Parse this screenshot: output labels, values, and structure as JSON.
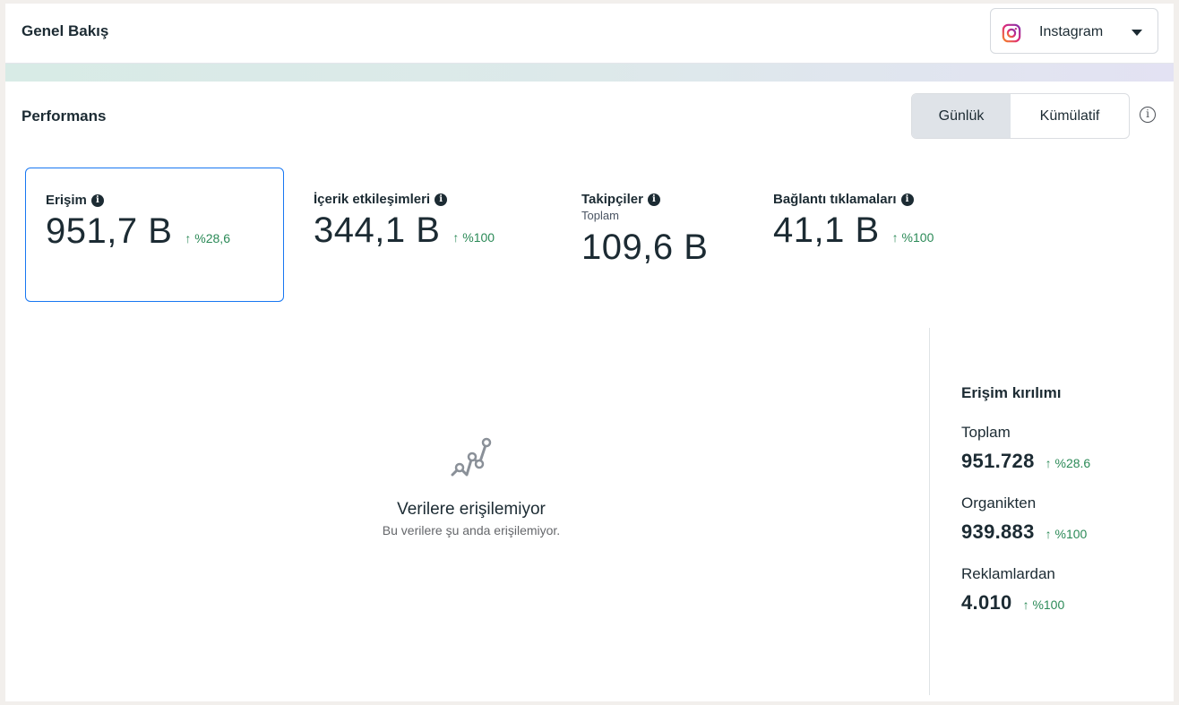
{
  "header": {
    "title": "Genel Bakış",
    "platform_select": {
      "label": "Instagram",
      "icon": "instagram-icon"
    }
  },
  "performance": {
    "title": "Performans",
    "toggle": {
      "active": "Günlük",
      "inactive": "Kümülatif"
    },
    "info_icon": "info-icon"
  },
  "metrics": [
    {
      "label": "Erişim",
      "value": "951,7 B",
      "change": "↑ %28,6",
      "selected": true
    },
    {
      "label": "İçerik etkileşimleri",
      "value": "344,1 B",
      "change": "↑ %100"
    },
    {
      "label": "Takipçiler",
      "sublabel": "Toplam",
      "value": "109,6 B",
      "change": ""
    },
    {
      "label": "Bağlantı tıklamaları",
      "value": "41,1 B",
      "change": "↑ %100"
    }
  ],
  "empty_state": {
    "icon": "line-chart-icon",
    "title": "Verilere erişilemiyor",
    "subtitle": "Bu verilere şu anda erişilemiyor."
  },
  "breakdown": {
    "title": "Erişim kırılımı",
    "items": [
      {
        "label": "Toplam",
        "value": "951.728",
        "change": "↑ %28.6"
      },
      {
        "label": "Organikten",
        "value": "939.883",
        "change": "↑ %100"
      },
      {
        "label": "Reklamlardan",
        "value": "4.010",
        "change": "↑ %100"
      }
    ]
  },
  "colors": {
    "accent_blue": "#1877f2",
    "positive_green": "#2b8a57",
    "text": "#1c2b33"
  }
}
